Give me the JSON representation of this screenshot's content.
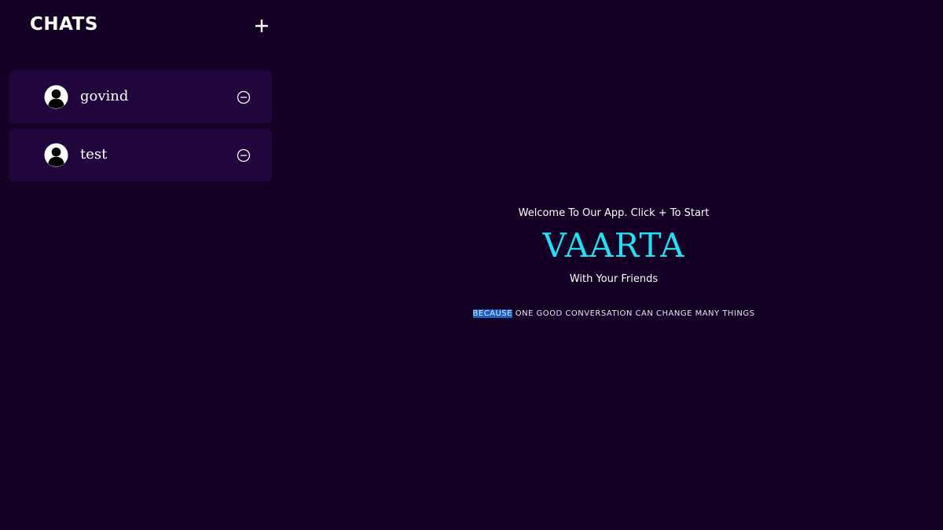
{
  "sidebar": {
    "title": "CHATS",
    "add_icon": "plus-icon",
    "chats": [
      {
        "name": "govind",
        "avatar_icon": "user-avatar-icon",
        "remove_icon": "minus-circle-icon"
      },
      {
        "name": "test",
        "avatar_icon": "user-avatar-icon",
        "remove_icon": "minus-circle-icon"
      }
    ]
  },
  "main": {
    "welcome_line1": "Welcome To Our App. Click + To Start",
    "brand": "VAARTA",
    "welcome_line2": "With Your Friends",
    "tagline_selected": "BECAUSE",
    "tagline_rest": " ONE GOOD CONVERSATION CAN CHANGE MANY THINGS"
  },
  "colors": {
    "background": "#150025",
    "chat_item": "#21053d",
    "brand": "#22e0f2",
    "selection": "#1f5fbf"
  }
}
